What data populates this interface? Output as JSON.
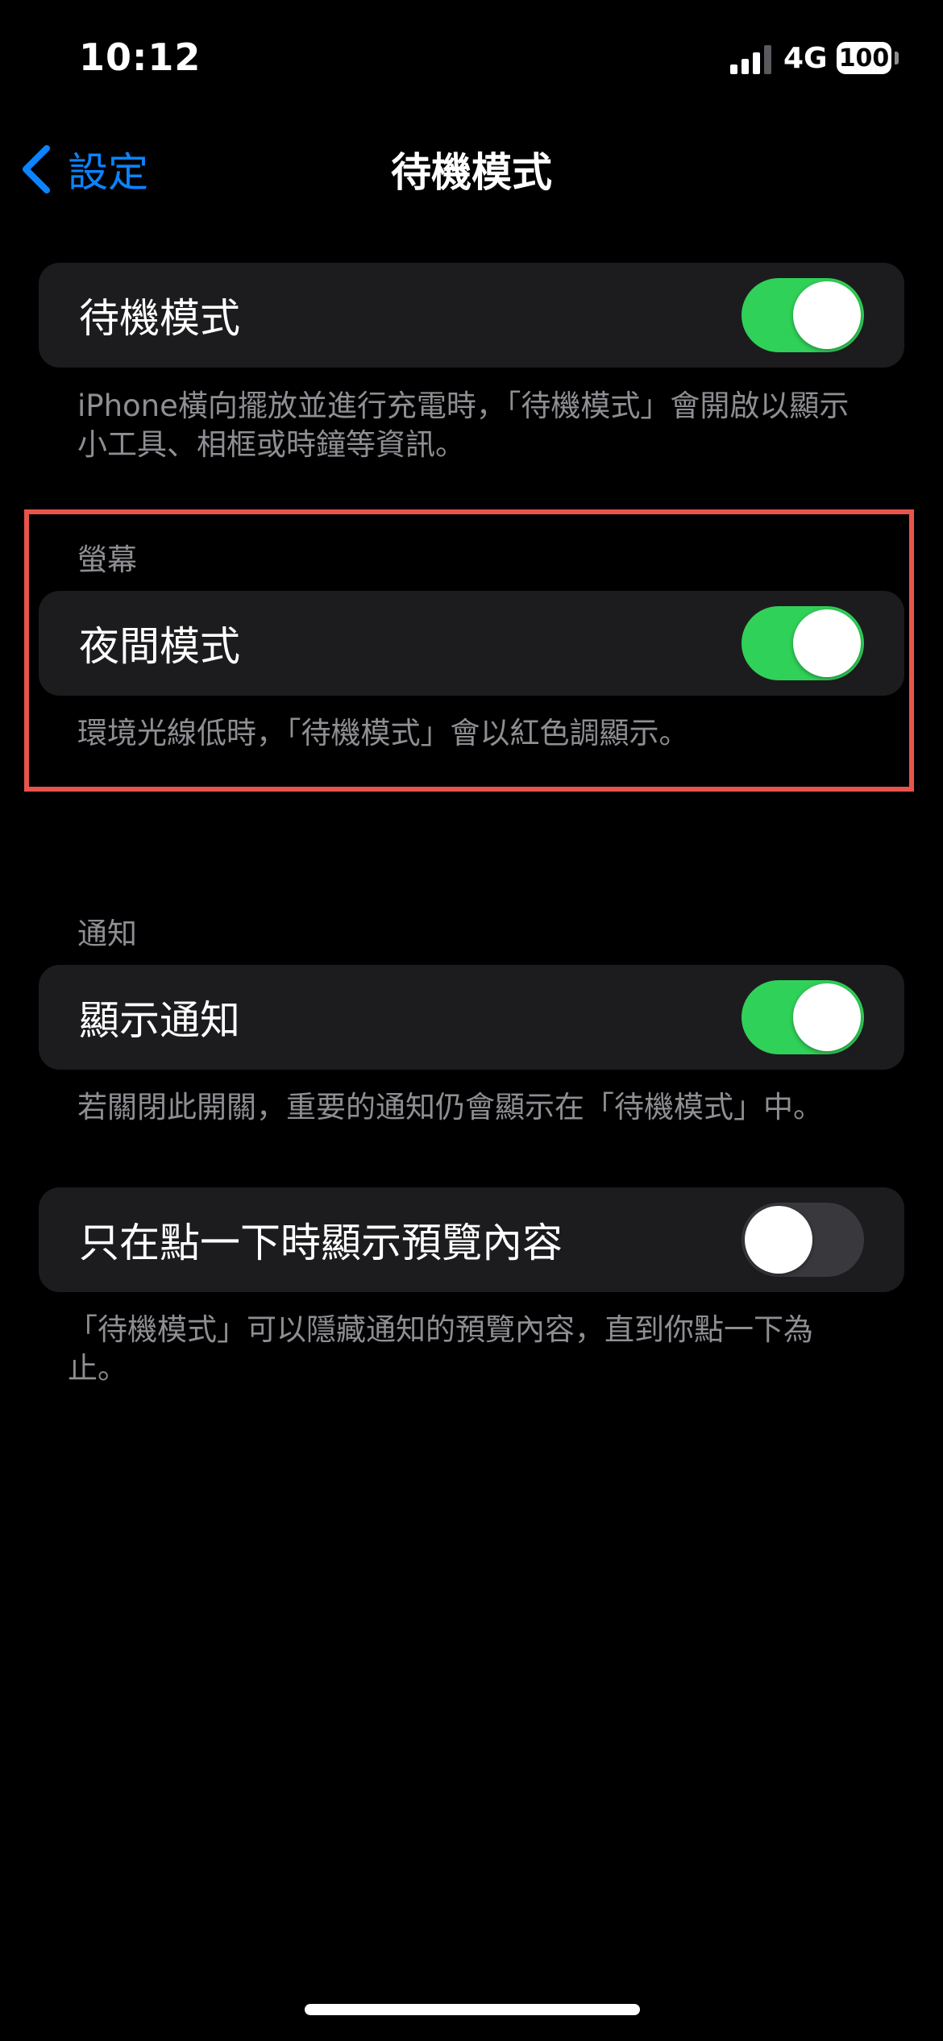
{
  "status_bar": {
    "time": "10:12",
    "network": "4G",
    "battery": "100"
  },
  "nav": {
    "back_label": "設定",
    "title": "待機模式"
  },
  "sections": {
    "standby": {
      "row_label": "待機模式",
      "toggle_on": true,
      "footer": "iPhone橫向擺放並進行充電時，「待機模式」會開啟以顯示小工具、相框或時鐘等資訊。"
    },
    "display": {
      "header": "螢幕",
      "row_label": "夜間模式",
      "toggle_on": true,
      "footer": "環境光線低時，「待機模式」會以紅色調顯示。"
    },
    "notifications": {
      "header": "通知",
      "row_label": "顯示通知",
      "toggle_on": true,
      "footer": "若關閉此開關，重要的通知仍會顯示在「待機模式」中。"
    },
    "preview": {
      "row_label": "只在點一下時顯示預覽內容",
      "toggle_on": false,
      "footer": "「待機模式」可以隱藏通知的預覽內容，直到你點一下為止。"
    }
  },
  "colors": {
    "background": "#000000",
    "card": "#1c1c1e",
    "accent_blue": "#0a84ff",
    "toggle_on": "#30d158",
    "toggle_off": "#39393d",
    "secondary_text": "#8e8e93",
    "highlight": "#e8544c"
  },
  "icons": {
    "back": "chevron-left-icon",
    "signal": "cellular-signal-icon",
    "battery": "battery-icon"
  }
}
